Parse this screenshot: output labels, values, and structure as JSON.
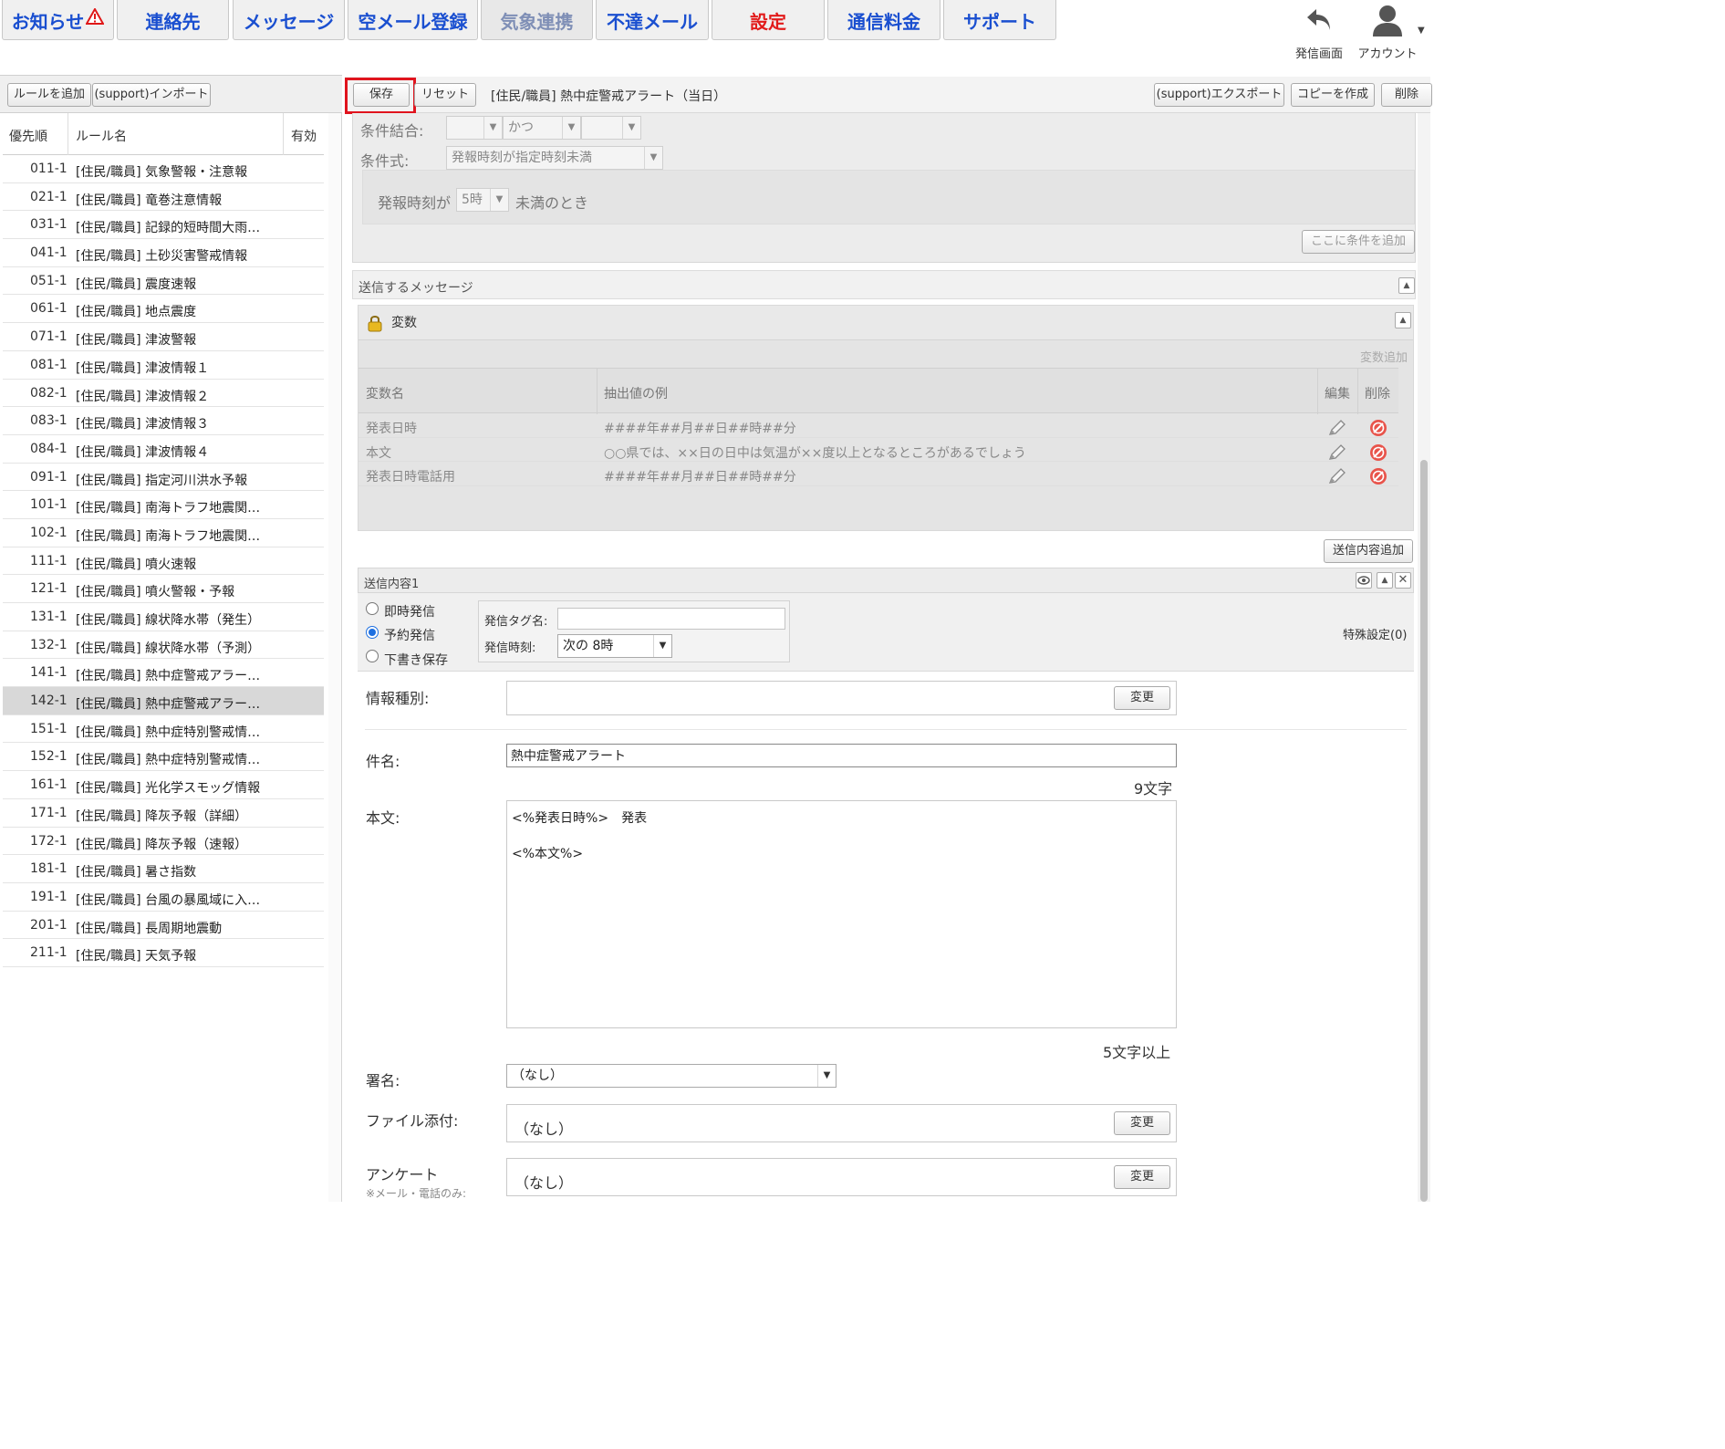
{
  "nav": {
    "tabs": [
      {
        "label": "お知らせ",
        "style": "normal"
      },
      {
        "label": "連絡先",
        "style": "normal"
      },
      {
        "label": "メッセージ",
        "style": "normal"
      },
      {
        "label": "空メール登録",
        "style": "normal"
      },
      {
        "label": "気象連携",
        "style": "dim"
      },
      {
        "label": "不達メール",
        "style": "normal"
      },
      {
        "label": "設定",
        "style": "red"
      },
      {
        "label": "通信料金",
        "style": "normal"
      },
      {
        "label": "サポート",
        "style": "normal"
      }
    ],
    "send_screen_label": "発信画面",
    "account_label": "アカウント",
    "icons": {
      "warning": "warning-icon",
      "back": "undo-arrow-icon",
      "account": "user-icon"
    }
  },
  "left": {
    "add_rule_label": "ルールを追加",
    "import_label": "(support)インポート",
    "columns": {
      "priority": "優先順",
      "name": "ルール名",
      "enabled": "有効"
    },
    "rules": [
      {
        "priority": "011-1",
        "name": "[住民/職員] 気象警報・注意報"
      },
      {
        "priority": "021-1",
        "name": "[住民/職員] 竜巻注意情報"
      },
      {
        "priority": "031-1",
        "name": "[住民/職員] 記録的短時間大雨…"
      },
      {
        "priority": "041-1",
        "name": "[住民/職員] 土砂災害警戒情報"
      },
      {
        "priority": "051-1",
        "name": "[住民/職員] 震度速報"
      },
      {
        "priority": "061-1",
        "name": "[住民/職員] 地点震度"
      },
      {
        "priority": "071-1",
        "name": "[住民/職員] 津波警報"
      },
      {
        "priority": "081-1",
        "name": "[住民/職員] 津波情報１"
      },
      {
        "priority": "082-1",
        "name": "[住民/職員] 津波情報２"
      },
      {
        "priority": "083-1",
        "name": "[住民/職員] 津波情報３"
      },
      {
        "priority": "084-1",
        "name": "[住民/職員] 津波情報４"
      },
      {
        "priority": "091-1",
        "name": "[住民/職員] 指定河川洪水予報"
      },
      {
        "priority": "101-1",
        "name": "[住民/職員] 南海トラフ地震関…"
      },
      {
        "priority": "102-1",
        "name": "[住民/職員] 南海トラフ地震関…"
      },
      {
        "priority": "111-1",
        "name": "[住民/職員] 噴火速報"
      },
      {
        "priority": "121-1",
        "name": "[住民/職員] 噴火警報・予報"
      },
      {
        "priority": "131-1",
        "name": "[住民/職員] 線状降水帯（発生）"
      },
      {
        "priority": "132-1",
        "name": "[住民/職員] 線状降水帯（予測）"
      },
      {
        "priority": "141-1",
        "name": "[住民/職員] 熱中症警戒アラー…"
      },
      {
        "priority": "142-1",
        "name": "[住民/職員] 熱中症警戒アラー…",
        "selected": true
      },
      {
        "priority": "151-1",
        "name": "[住民/職員] 熱中症特別警戒情…"
      },
      {
        "priority": "152-1",
        "name": "[住民/職員] 熱中症特別警戒情…"
      },
      {
        "priority": "161-1",
        "name": "[住民/職員] 光化学スモッグ情報"
      },
      {
        "priority": "171-1",
        "name": "[住民/職員] 降灰予報（詳細）"
      },
      {
        "priority": "172-1",
        "name": "[住民/職員] 降灰予報（速報）"
      },
      {
        "priority": "181-1",
        "name": "[住民/職員] 暑さ指数"
      },
      {
        "priority": "191-1",
        "name": "[住民/職員] 台風の暴風域に入…"
      },
      {
        "priority": "201-1",
        "name": "[住民/職員] 長周期地震動"
      },
      {
        "priority": "211-1",
        "name": "[住民/職員] 天気予報"
      }
    ]
  },
  "toolbar": {
    "save_label": "保存",
    "reset_label": "リセット",
    "rule_title": "[住民/職員] 熱中症警戒アラート（当日）",
    "export_label": "(support)エクスポート",
    "copy_label": "コピーを作成",
    "delete_label": "削除",
    "highlight_color": "#e0141e"
  },
  "conditions": {
    "combine_label": "条件結合:",
    "combine_value": "かつ",
    "expr_label": "条件式:",
    "expr_value": "発報時刻が指定時刻未満",
    "detail_prefix": "発報時刻が",
    "detail_value": "5時",
    "detail_suffix": "未満のとき",
    "add_label": "ここに条件を追加"
  },
  "messages": {
    "header": "送信するメッセージ",
    "vars_title": "変数",
    "vars_add_label": "変数追加",
    "vars_columns": {
      "name": "変数名",
      "example": "抽出値の例",
      "edit": "編集",
      "delete": "削除"
    },
    "variables": [
      {
        "name": "発表日時",
        "example": "####年##月##日##時##分"
      },
      {
        "name": "本文",
        "example": "○○県では、××日の日中は気温が××度以上となるところがあるでしょう"
      },
      {
        "name": "発表日時電話用",
        "example": "####年##月##日##時##分"
      }
    ],
    "add_content_label": "送信内容追加"
  },
  "content1": {
    "title": "送信内容1",
    "send_modes": [
      {
        "label": "即時発信",
        "checked": false
      },
      {
        "label": "予約発信",
        "checked": true
      },
      {
        "label": "下書き保存",
        "checked": false
      }
    ],
    "tag_label": "発信タグ名:",
    "tag_value": "",
    "time_label": "発信時刻:",
    "time_value": "次の 8時",
    "special_label": "特殊設定(0)",
    "info_type_label": "情報種別:",
    "change_label": "変更",
    "subject_label": "件名:",
    "subject_value": "熱中症警戒アラート",
    "subject_count": "9文字",
    "body_label": "本文:",
    "body_line1": "<%発表日時%>　発表",
    "body_line2": "<%本文%>",
    "body_count": "5文字以上",
    "signature_label": "署名:",
    "signature_value": "（なし）",
    "attach_label": "ファイル添付:",
    "attach_value": "（なし）",
    "survey_label": "アンケート",
    "survey_note": "※メール・電話のみ:",
    "survey_value": "（なし）"
  }
}
